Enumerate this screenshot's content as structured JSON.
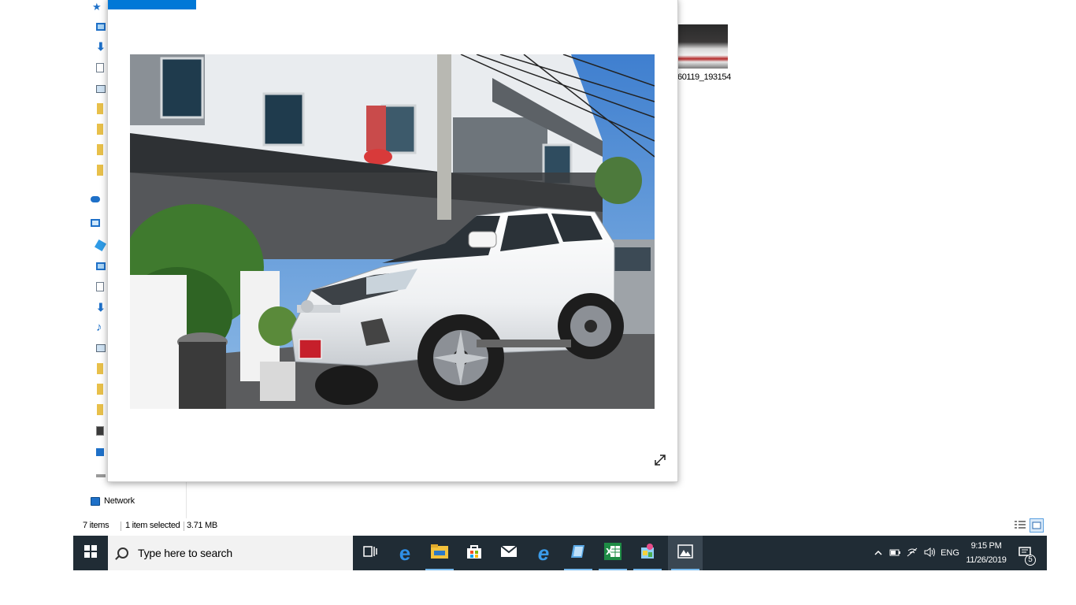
{
  "explorer": {
    "nav_items": [
      {
        "icon": "quick-access-star-icon"
      },
      {
        "icon": "desktop-icon"
      },
      {
        "icon": "downloads-icon"
      },
      {
        "icon": "documents-icon"
      },
      {
        "icon": "pictures-icon"
      },
      {
        "icon": "folder-icon"
      },
      {
        "icon": "folder-icon"
      },
      {
        "icon": "folder-icon"
      },
      {
        "icon": "folder-icon"
      },
      {
        "icon": "onedrive-cloud-icon"
      },
      {
        "icon": "this-pc-icon"
      },
      {
        "icon": "3d-objects-icon"
      },
      {
        "icon": "desktop-icon"
      },
      {
        "icon": "documents-icon"
      },
      {
        "icon": "downloads-icon"
      },
      {
        "icon": "music-icon"
      },
      {
        "icon": "pictures-icon"
      },
      {
        "icon": "folder-icon"
      },
      {
        "icon": "folder-icon"
      },
      {
        "icon": "folder-icon"
      },
      {
        "icon": "phone-icon"
      },
      {
        "icon": "windows-drive-icon"
      },
      {
        "icon": "drive-icon"
      }
    ],
    "network_label": "Network",
    "thumbnail_label": "60119_193154",
    "status": {
      "item_count": "7 items",
      "selection": "1 item selected",
      "size": "3.71 MB"
    }
  },
  "photo_viewer": {
    "expand_icon": "expand-diagonal-arrow-icon"
  },
  "taskbar": {
    "search_placeholder": "Type here to search",
    "apps": [
      {
        "name": "task-view",
        "icon": "task-view-icon"
      },
      {
        "name": "edge",
        "icon": "edge-e-icon"
      },
      {
        "name": "file-explorer",
        "icon": "folder-icon"
      },
      {
        "name": "store",
        "icon": "store-bag-icon"
      },
      {
        "name": "mail",
        "icon": "mail-envelope-icon"
      },
      {
        "name": "internet-explorer",
        "icon": "ie-e-icon"
      },
      {
        "name": "app-blue",
        "icon": "blue-book-icon"
      },
      {
        "name": "excel",
        "icon": "excel-spreadsheet-icon"
      },
      {
        "name": "app-paint",
        "icon": "paint-icon"
      },
      {
        "name": "photos",
        "icon": "photos-icon"
      }
    ],
    "tray": {
      "language": "ENG",
      "time": "9:15 PM",
      "date": "11/26/2019",
      "notification_count": "5"
    }
  },
  "colors": {
    "taskbar_bg": "#202c35",
    "accent": "#0078d7",
    "active_underline": "#76b9ed"
  }
}
